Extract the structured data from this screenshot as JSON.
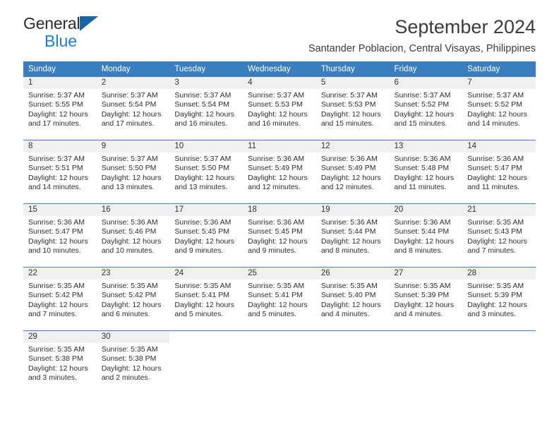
{
  "logo": {
    "word_general": "General",
    "word_blue": "Blue",
    "triangle_color": "#1565a8",
    "blue_color": "#1a7fd4"
  },
  "header": {
    "title": "September 2024",
    "subtitle": "Santander Poblacion, Central Visayas, Philippines",
    "header_bg": "#3a7ebf",
    "row_divider": "#4a80b8",
    "daynum_band_bg": "#f0f0f0"
  },
  "weekdays": [
    "Sunday",
    "Monday",
    "Tuesday",
    "Wednesday",
    "Thursday",
    "Friday",
    "Saturday"
  ],
  "weeks": [
    [
      {
        "day": "1",
        "sunrise": "Sunrise: 5:37 AM",
        "sunset": "Sunset: 5:55 PM",
        "daylight1": "Daylight: 12 hours",
        "daylight2": "and 17 minutes."
      },
      {
        "day": "2",
        "sunrise": "Sunrise: 5:37 AM",
        "sunset": "Sunset: 5:54 PM",
        "daylight1": "Daylight: 12 hours",
        "daylight2": "and 17 minutes."
      },
      {
        "day": "3",
        "sunrise": "Sunrise: 5:37 AM",
        "sunset": "Sunset: 5:54 PM",
        "daylight1": "Daylight: 12 hours",
        "daylight2": "and 16 minutes."
      },
      {
        "day": "4",
        "sunrise": "Sunrise: 5:37 AM",
        "sunset": "Sunset: 5:53 PM",
        "daylight1": "Daylight: 12 hours",
        "daylight2": "and 16 minutes."
      },
      {
        "day": "5",
        "sunrise": "Sunrise: 5:37 AM",
        "sunset": "Sunset: 5:53 PM",
        "daylight1": "Daylight: 12 hours",
        "daylight2": "and 15 minutes."
      },
      {
        "day": "6",
        "sunrise": "Sunrise: 5:37 AM",
        "sunset": "Sunset: 5:52 PM",
        "daylight1": "Daylight: 12 hours",
        "daylight2": "and 15 minutes."
      },
      {
        "day": "7",
        "sunrise": "Sunrise: 5:37 AM",
        "sunset": "Sunset: 5:52 PM",
        "daylight1": "Daylight: 12 hours",
        "daylight2": "and 14 minutes."
      }
    ],
    [
      {
        "day": "8",
        "sunrise": "Sunrise: 5:37 AM",
        "sunset": "Sunset: 5:51 PM",
        "daylight1": "Daylight: 12 hours",
        "daylight2": "and 14 minutes."
      },
      {
        "day": "9",
        "sunrise": "Sunrise: 5:37 AM",
        "sunset": "Sunset: 5:50 PM",
        "daylight1": "Daylight: 12 hours",
        "daylight2": "and 13 minutes."
      },
      {
        "day": "10",
        "sunrise": "Sunrise: 5:37 AM",
        "sunset": "Sunset: 5:50 PM",
        "daylight1": "Daylight: 12 hours",
        "daylight2": "and 13 minutes."
      },
      {
        "day": "11",
        "sunrise": "Sunrise: 5:36 AM",
        "sunset": "Sunset: 5:49 PM",
        "daylight1": "Daylight: 12 hours",
        "daylight2": "and 12 minutes."
      },
      {
        "day": "12",
        "sunrise": "Sunrise: 5:36 AM",
        "sunset": "Sunset: 5:49 PM",
        "daylight1": "Daylight: 12 hours",
        "daylight2": "and 12 minutes."
      },
      {
        "day": "13",
        "sunrise": "Sunrise: 5:36 AM",
        "sunset": "Sunset: 5:48 PM",
        "daylight1": "Daylight: 12 hours",
        "daylight2": "and 11 minutes."
      },
      {
        "day": "14",
        "sunrise": "Sunrise: 5:36 AM",
        "sunset": "Sunset: 5:47 PM",
        "daylight1": "Daylight: 12 hours",
        "daylight2": "and 11 minutes."
      }
    ],
    [
      {
        "day": "15",
        "sunrise": "Sunrise: 5:36 AM",
        "sunset": "Sunset: 5:47 PM",
        "daylight1": "Daylight: 12 hours",
        "daylight2": "and 10 minutes."
      },
      {
        "day": "16",
        "sunrise": "Sunrise: 5:36 AM",
        "sunset": "Sunset: 5:46 PM",
        "daylight1": "Daylight: 12 hours",
        "daylight2": "and 10 minutes."
      },
      {
        "day": "17",
        "sunrise": "Sunrise: 5:36 AM",
        "sunset": "Sunset: 5:45 PM",
        "daylight1": "Daylight: 12 hours",
        "daylight2": "and 9 minutes."
      },
      {
        "day": "18",
        "sunrise": "Sunrise: 5:36 AM",
        "sunset": "Sunset: 5:45 PM",
        "daylight1": "Daylight: 12 hours",
        "daylight2": "and 9 minutes."
      },
      {
        "day": "19",
        "sunrise": "Sunrise: 5:36 AM",
        "sunset": "Sunset: 5:44 PM",
        "daylight1": "Daylight: 12 hours",
        "daylight2": "and 8 minutes."
      },
      {
        "day": "20",
        "sunrise": "Sunrise: 5:36 AM",
        "sunset": "Sunset: 5:44 PM",
        "daylight1": "Daylight: 12 hours",
        "daylight2": "and 8 minutes."
      },
      {
        "day": "21",
        "sunrise": "Sunrise: 5:35 AM",
        "sunset": "Sunset: 5:43 PM",
        "daylight1": "Daylight: 12 hours",
        "daylight2": "and 7 minutes."
      }
    ],
    [
      {
        "day": "22",
        "sunrise": "Sunrise: 5:35 AM",
        "sunset": "Sunset: 5:42 PM",
        "daylight1": "Daylight: 12 hours",
        "daylight2": "and 7 minutes."
      },
      {
        "day": "23",
        "sunrise": "Sunrise: 5:35 AM",
        "sunset": "Sunset: 5:42 PM",
        "daylight1": "Daylight: 12 hours",
        "daylight2": "and 6 minutes."
      },
      {
        "day": "24",
        "sunrise": "Sunrise: 5:35 AM",
        "sunset": "Sunset: 5:41 PM",
        "daylight1": "Daylight: 12 hours",
        "daylight2": "and 5 minutes."
      },
      {
        "day": "25",
        "sunrise": "Sunrise: 5:35 AM",
        "sunset": "Sunset: 5:41 PM",
        "daylight1": "Daylight: 12 hours",
        "daylight2": "and 5 minutes."
      },
      {
        "day": "26",
        "sunrise": "Sunrise: 5:35 AM",
        "sunset": "Sunset: 5:40 PM",
        "daylight1": "Daylight: 12 hours",
        "daylight2": "and 4 minutes."
      },
      {
        "day": "27",
        "sunrise": "Sunrise: 5:35 AM",
        "sunset": "Sunset: 5:39 PM",
        "daylight1": "Daylight: 12 hours",
        "daylight2": "and 4 minutes."
      },
      {
        "day": "28",
        "sunrise": "Sunrise: 5:35 AM",
        "sunset": "Sunset: 5:39 PM",
        "daylight1": "Daylight: 12 hours",
        "daylight2": "and 3 minutes."
      }
    ],
    [
      {
        "day": "29",
        "sunrise": "Sunrise: 5:35 AM",
        "sunset": "Sunset: 5:38 PM",
        "daylight1": "Daylight: 12 hours",
        "daylight2": "and 3 minutes."
      },
      {
        "day": "30",
        "sunrise": "Sunrise: 5:35 AM",
        "sunset": "Sunset: 5:38 PM",
        "daylight1": "Daylight: 12 hours",
        "daylight2": "and 2 minutes."
      },
      {
        "day": "",
        "sunrise": "",
        "sunset": "",
        "daylight1": "",
        "daylight2": ""
      },
      {
        "day": "",
        "sunrise": "",
        "sunset": "",
        "daylight1": "",
        "daylight2": ""
      },
      {
        "day": "",
        "sunrise": "",
        "sunset": "",
        "daylight1": "",
        "daylight2": ""
      },
      {
        "day": "",
        "sunrise": "",
        "sunset": "",
        "daylight1": "",
        "daylight2": ""
      },
      {
        "day": "",
        "sunrise": "",
        "sunset": "",
        "daylight1": "",
        "daylight2": ""
      }
    ]
  ]
}
